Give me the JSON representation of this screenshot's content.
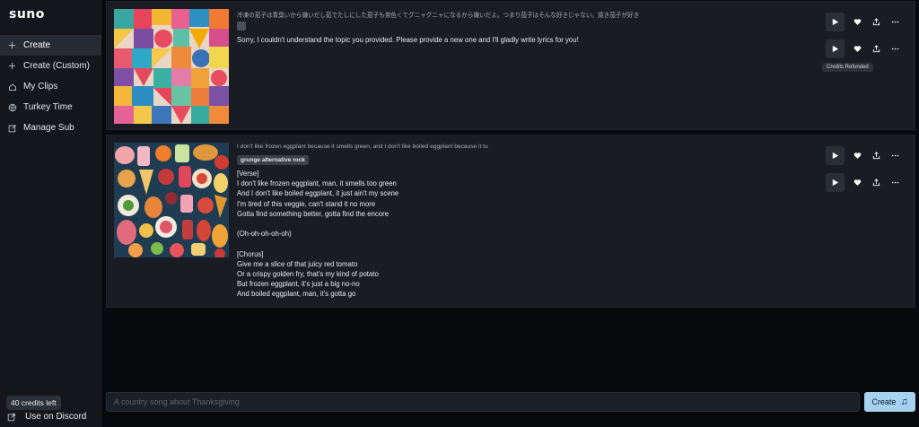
{
  "app": {
    "logo": "suno"
  },
  "sidebar": {
    "items": [
      {
        "label": "Create",
        "icon": "plus-icon",
        "active": true
      },
      {
        "label": "Create (Custom)",
        "icon": "plus-icon",
        "active": false
      },
      {
        "label": "My Clips",
        "icon": "home-icon",
        "active": false
      },
      {
        "label": "Turkey Time",
        "icon": "globe-icon",
        "active": false
      },
      {
        "label": "Manage Sub",
        "icon": "edit-icon",
        "active": false
      }
    ],
    "credits": "40 credits left",
    "discord": "Use on Discord"
  },
  "clips": [
    {
      "prompt": "冷凍の茄子は青臭いから嫌いだし茹でたしにした茄子も茶色くてグニャグニャになるから嫌いだよ。つまり茄子はそんな好きじゃない。焼き茄子が好き",
      "text": "Sorry, I couldn't understand the topic you provided. Please provide a new one and I'll gladly write lyrics for you!",
      "tooltip": "Credits Refunded"
    },
    {
      "prompt": "I don't like frozen eggplant because it smells green, and I don't like boiled eggplant because it tu",
      "tag": "grunge alternative rock",
      "lyrics": "[Verse]\nI don't like frozen eggplant, man, it smells too green\nAnd I don't like boiled eggplant, it just ain't my scene\nI'm tired of this veggie, can't stand it no more\nGotta find something better, gotta find the encore\n\n(Oh-oh-oh-oh-oh)\n\n[Chorus]\nGive me a slice of that juicy red tomato\nOr a crispy golden fry, that's my kind of potato\nBut frozen eggplant, it's just a big no-no\nAnd boiled eggplant, man, it's gotta go"
    }
  ],
  "composer": {
    "placeholder": "A country song about Thanksgiving",
    "button_label": "Create",
    "button_icon": "music-note-icon"
  },
  "colors": {
    "accent": "#a6d2f0",
    "sidebar": "#14161b",
    "card": "#191c23",
    "background": "#08090c"
  }
}
